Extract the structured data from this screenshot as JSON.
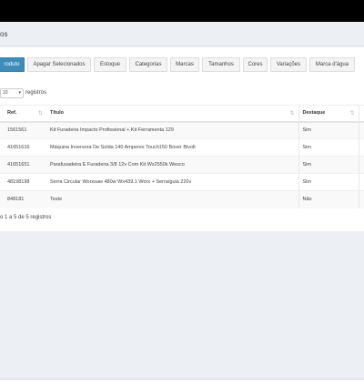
{
  "header": {
    "title": "os"
  },
  "toolbar": {
    "buttons": [
      {
        "label": "roduto"
      },
      {
        "label": "Apagar Selecionados"
      },
      {
        "label": "Estoque"
      },
      {
        "label": "Categorias"
      },
      {
        "label": "Marcas"
      },
      {
        "label": "Tamanhos"
      },
      {
        "label": "Cores"
      },
      {
        "label": "Variações"
      },
      {
        "label": "Marca d'água"
      }
    ]
  },
  "length": {
    "value": "10",
    "suffix": "registros"
  },
  "table": {
    "headers": [
      "Ref.",
      "Título",
      "Destaque"
    ],
    "rows": [
      {
        "ref": "1561561",
        "title": "Kit Furadeira Impacto Profissional + Kit Ferramenta 129",
        "destaque": "Sim"
      },
      {
        "ref": "41651616",
        "title": "Máquina Inversora De Solda 140 Amperes Touch150 Boxer Bivolt",
        "destaque": "Sim"
      },
      {
        "ref": "41651651",
        "title": "Parafusadeira E Furadeira 3/8 12v Com Kit Ws2550k Wesco",
        "destaque": "Sim"
      },
      {
        "ref": "48198198",
        "title": "Serra Circular Worxsaw 480w Wx439.1 Worx + Serra/guia 220v",
        "destaque": "Sim"
      },
      {
        "ref": "848181",
        "title": "Teste",
        "destaque": "Não"
      }
    ]
  },
  "info": "o 1 a 5 de 5 registros"
}
